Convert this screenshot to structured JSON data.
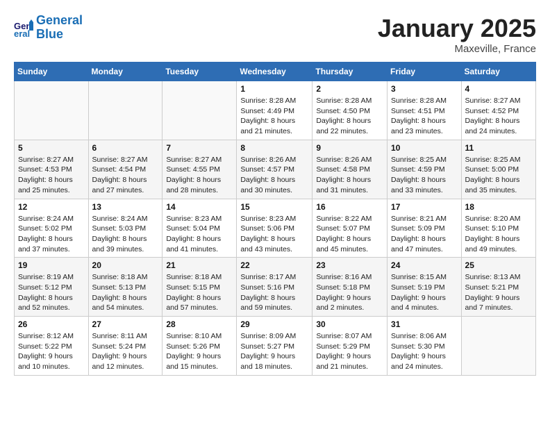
{
  "header": {
    "logo_line1": "General",
    "logo_line2": "Blue",
    "title": "January 2025",
    "subtitle": "Maxeville, France"
  },
  "weekdays": [
    "Sunday",
    "Monday",
    "Tuesday",
    "Wednesday",
    "Thursday",
    "Friday",
    "Saturday"
  ],
  "weeks": [
    [
      {
        "day": "",
        "info": ""
      },
      {
        "day": "",
        "info": ""
      },
      {
        "day": "",
        "info": ""
      },
      {
        "day": "1",
        "info": "Sunrise: 8:28 AM\nSunset: 4:49 PM\nDaylight: 8 hours\nand 21 minutes."
      },
      {
        "day": "2",
        "info": "Sunrise: 8:28 AM\nSunset: 4:50 PM\nDaylight: 8 hours\nand 22 minutes."
      },
      {
        "day": "3",
        "info": "Sunrise: 8:28 AM\nSunset: 4:51 PM\nDaylight: 8 hours\nand 23 minutes."
      },
      {
        "day": "4",
        "info": "Sunrise: 8:27 AM\nSunset: 4:52 PM\nDaylight: 8 hours\nand 24 minutes."
      }
    ],
    [
      {
        "day": "5",
        "info": "Sunrise: 8:27 AM\nSunset: 4:53 PM\nDaylight: 8 hours\nand 25 minutes."
      },
      {
        "day": "6",
        "info": "Sunrise: 8:27 AM\nSunset: 4:54 PM\nDaylight: 8 hours\nand 27 minutes."
      },
      {
        "day": "7",
        "info": "Sunrise: 8:27 AM\nSunset: 4:55 PM\nDaylight: 8 hours\nand 28 minutes."
      },
      {
        "day": "8",
        "info": "Sunrise: 8:26 AM\nSunset: 4:57 PM\nDaylight: 8 hours\nand 30 minutes."
      },
      {
        "day": "9",
        "info": "Sunrise: 8:26 AM\nSunset: 4:58 PM\nDaylight: 8 hours\nand 31 minutes."
      },
      {
        "day": "10",
        "info": "Sunrise: 8:25 AM\nSunset: 4:59 PM\nDaylight: 8 hours\nand 33 minutes."
      },
      {
        "day": "11",
        "info": "Sunrise: 8:25 AM\nSunset: 5:00 PM\nDaylight: 8 hours\nand 35 minutes."
      }
    ],
    [
      {
        "day": "12",
        "info": "Sunrise: 8:24 AM\nSunset: 5:02 PM\nDaylight: 8 hours\nand 37 minutes."
      },
      {
        "day": "13",
        "info": "Sunrise: 8:24 AM\nSunset: 5:03 PM\nDaylight: 8 hours\nand 39 minutes."
      },
      {
        "day": "14",
        "info": "Sunrise: 8:23 AM\nSunset: 5:04 PM\nDaylight: 8 hours\nand 41 minutes."
      },
      {
        "day": "15",
        "info": "Sunrise: 8:23 AM\nSunset: 5:06 PM\nDaylight: 8 hours\nand 43 minutes."
      },
      {
        "day": "16",
        "info": "Sunrise: 8:22 AM\nSunset: 5:07 PM\nDaylight: 8 hours\nand 45 minutes."
      },
      {
        "day": "17",
        "info": "Sunrise: 8:21 AM\nSunset: 5:09 PM\nDaylight: 8 hours\nand 47 minutes."
      },
      {
        "day": "18",
        "info": "Sunrise: 8:20 AM\nSunset: 5:10 PM\nDaylight: 8 hours\nand 49 minutes."
      }
    ],
    [
      {
        "day": "19",
        "info": "Sunrise: 8:19 AM\nSunset: 5:12 PM\nDaylight: 8 hours\nand 52 minutes."
      },
      {
        "day": "20",
        "info": "Sunrise: 8:18 AM\nSunset: 5:13 PM\nDaylight: 8 hours\nand 54 minutes."
      },
      {
        "day": "21",
        "info": "Sunrise: 8:18 AM\nSunset: 5:15 PM\nDaylight: 8 hours\nand 57 minutes."
      },
      {
        "day": "22",
        "info": "Sunrise: 8:17 AM\nSunset: 5:16 PM\nDaylight: 8 hours\nand 59 minutes."
      },
      {
        "day": "23",
        "info": "Sunrise: 8:16 AM\nSunset: 5:18 PM\nDaylight: 9 hours\nand 2 minutes."
      },
      {
        "day": "24",
        "info": "Sunrise: 8:15 AM\nSunset: 5:19 PM\nDaylight: 9 hours\nand 4 minutes."
      },
      {
        "day": "25",
        "info": "Sunrise: 8:13 AM\nSunset: 5:21 PM\nDaylight: 9 hours\nand 7 minutes."
      }
    ],
    [
      {
        "day": "26",
        "info": "Sunrise: 8:12 AM\nSunset: 5:22 PM\nDaylight: 9 hours\nand 10 minutes."
      },
      {
        "day": "27",
        "info": "Sunrise: 8:11 AM\nSunset: 5:24 PM\nDaylight: 9 hours\nand 12 minutes."
      },
      {
        "day": "28",
        "info": "Sunrise: 8:10 AM\nSunset: 5:26 PM\nDaylight: 9 hours\nand 15 minutes."
      },
      {
        "day": "29",
        "info": "Sunrise: 8:09 AM\nSunset: 5:27 PM\nDaylight: 9 hours\nand 18 minutes."
      },
      {
        "day": "30",
        "info": "Sunrise: 8:07 AM\nSunset: 5:29 PM\nDaylight: 9 hours\nand 21 minutes."
      },
      {
        "day": "31",
        "info": "Sunrise: 8:06 AM\nSunset: 5:30 PM\nDaylight: 9 hours\nand 24 minutes."
      },
      {
        "day": "",
        "info": ""
      }
    ]
  ]
}
